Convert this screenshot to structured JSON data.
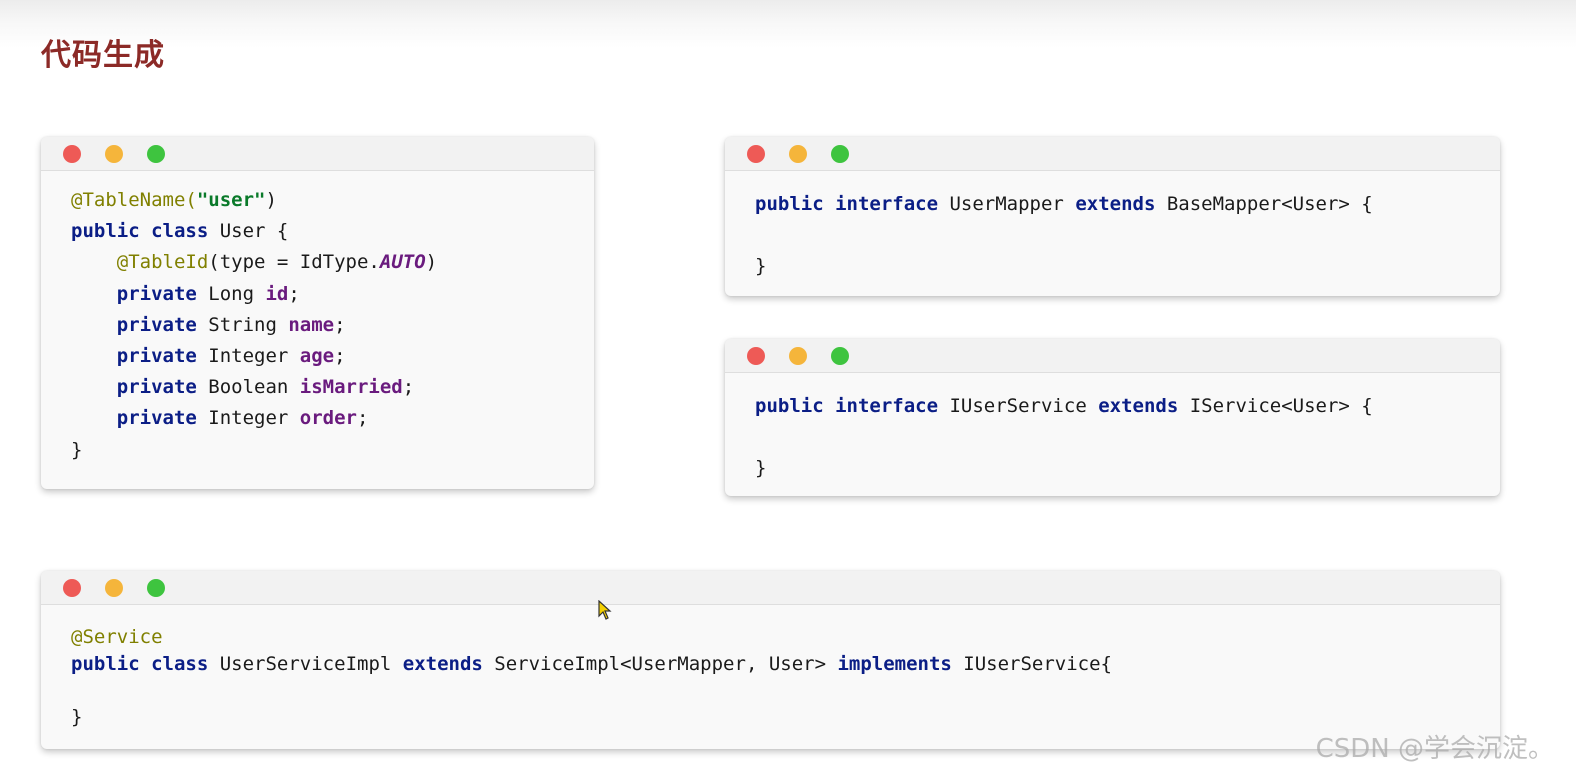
{
  "page": {
    "title": "代码生成"
  },
  "windows": {
    "entity": {
      "lines": [
        [
          {
            "t": "@TableName(",
            "c": "ann"
          },
          {
            "t": "\"user\"",
            "c": "str"
          },
          {
            "t": ")",
            "c": "plain"
          }
        ],
        [
          {
            "t": "public",
            "c": "kw"
          },
          {
            "t": " ",
            "c": "plain"
          },
          {
            "t": "class",
            "c": "kw"
          },
          {
            "t": " User {",
            "c": "plain"
          }
        ],
        [
          {
            "t": "    ",
            "c": "plain"
          },
          {
            "t": "@TableId",
            "c": "ann"
          },
          {
            "t": "(type = IdType.",
            "c": "plain"
          },
          {
            "t": "AUTO",
            "c": "const"
          },
          {
            "t": ")",
            "c": "plain"
          }
        ],
        [
          {
            "t": "    ",
            "c": "plain"
          },
          {
            "t": "private",
            "c": "kw"
          },
          {
            "t": " Long ",
            "c": "plain"
          },
          {
            "t": "id",
            "c": "fld"
          },
          {
            "t": ";",
            "c": "plain"
          }
        ],
        [
          {
            "t": "    ",
            "c": "plain"
          },
          {
            "t": "private",
            "c": "kw"
          },
          {
            "t": " String ",
            "c": "plain"
          },
          {
            "t": "name",
            "c": "fld"
          },
          {
            "t": ";",
            "c": "plain"
          }
        ],
        [
          {
            "t": "    ",
            "c": "plain"
          },
          {
            "t": "private",
            "c": "kw"
          },
          {
            "t": " Integer ",
            "c": "plain"
          },
          {
            "t": "age",
            "c": "fld"
          },
          {
            "t": ";",
            "c": "plain"
          }
        ],
        [
          {
            "t": "    ",
            "c": "plain"
          },
          {
            "t": "private",
            "c": "kw"
          },
          {
            "t": " Boolean ",
            "c": "plain"
          },
          {
            "t": "isMarried",
            "c": "fld"
          },
          {
            "t": ";",
            "c": "plain"
          }
        ],
        [
          {
            "t": "    ",
            "c": "plain"
          },
          {
            "t": "private",
            "c": "kw"
          },
          {
            "t": " Integer ",
            "c": "plain"
          },
          {
            "t": "order",
            "c": "fld"
          },
          {
            "t": ";",
            "c": "plain"
          }
        ],
        [
          {
            "t": "}",
            "c": "plain"
          }
        ]
      ]
    },
    "mapper": {
      "lines": [
        [
          {
            "t": "public",
            "c": "kw"
          },
          {
            "t": " ",
            "c": "plain"
          },
          {
            "t": "interface",
            "c": "kw"
          },
          {
            "t": " UserMapper ",
            "c": "plain"
          },
          {
            "t": "extends",
            "c": "kw"
          },
          {
            "t": " BaseMapper<User> {",
            "c": "plain"
          }
        ],
        [
          {
            "t": "",
            "c": "plain"
          }
        ],
        [
          {
            "t": "}",
            "c": "plain"
          }
        ]
      ]
    },
    "service": {
      "lines": [
        [
          {
            "t": "public",
            "c": "kw"
          },
          {
            "t": " ",
            "c": "plain"
          },
          {
            "t": "interface",
            "c": "kw"
          },
          {
            "t": " IUserService ",
            "c": "plain"
          },
          {
            "t": "extends",
            "c": "kw"
          },
          {
            "t": " IService<User> {",
            "c": "plain"
          }
        ],
        [
          {
            "t": "",
            "c": "plain"
          }
        ],
        [
          {
            "t": "}",
            "c": "plain"
          }
        ]
      ]
    },
    "impl": {
      "lines": [
        [
          {
            "t": "@Service",
            "c": "ann"
          }
        ],
        [
          {
            "t": "public",
            "c": "kw"
          },
          {
            "t": " ",
            "c": "plain"
          },
          {
            "t": "class",
            "c": "kw"
          },
          {
            "t": " UserServiceImpl ",
            "c": "plain"
          },
          {
            "t": "extends",
            "c": "kw"
          },
          {
            "t": " ServiceImpl<UserMapper, User> ",
            "c": "plain"
          },
          {
            "t": "implements",
            "c": "kw"
          },
          {
            "t": " IUserService{",
            "c": "plain"
          }
        ],
        [
          {
            "t": "",
            "c": "plain"
          }
        ],
        [
          {
            "t": "}",
            "c": "plain"
          }
        ]
      ]
    }
  },
  "watermark": "CSDN @学会沉淀。"
}
